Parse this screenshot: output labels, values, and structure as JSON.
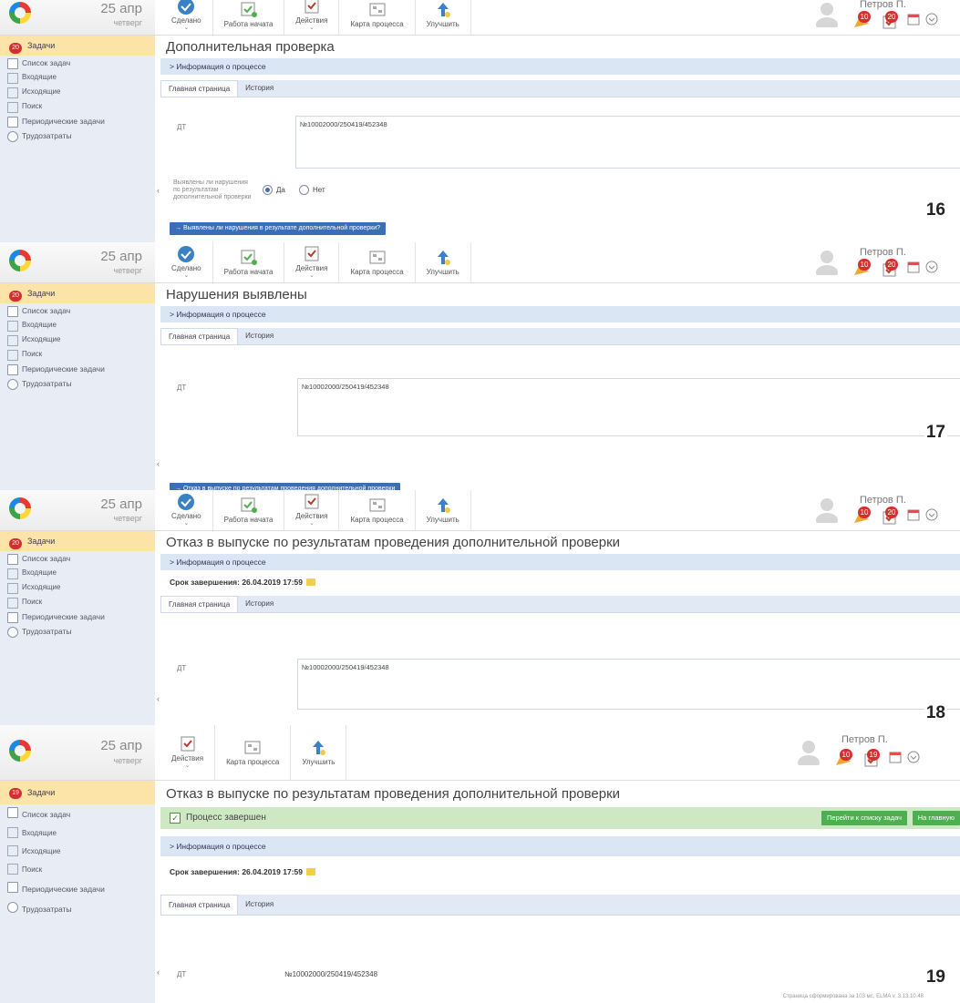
{
  "header": {
    "date_day": "25 апр",
    "weekday": "четверг",
    "user_name": "Петров П.",
    "user_name_partial": "Петров П."
  },
  "toolbar": {
    "done": "Сделано",
    "work_started": "Работа начата",
    "actions": "Действия",
    "process_map": "Карта процесса",
    "improve": "Улучшить"
  },
  "badges": {
    "notifications": "10",
    "tasks": "20",
    "tasks_last": "19"
  },
  "sidebar": {
    "tasks": "Задачи",
    "tasks_count": "20",
    "tasks_count_last": "19",
    "task_list": "Список задач",
    "incoming": "Входящие",
    "outgoing": "Исходящие",
    "search": "Поиск",
    "periodic": "Периодические задачи",
    "labor": "Трудозатраты"
  },
  "common": {
    "process_info": "> Информация о процессе",
    "tab_main": "Главная страница",
    "tab_history": "История",
    "field_dt": "ДТ",
    "dt_value": "№10002000/250419/452348",
    "deadline": "Срок завершения: 26.04.2019 17:59"
  },
  "panels": [
    {
      "number": "16",
      "title": "Дополнительная проверка",
      "question": "Выявлены ли нарушения по результатам дополнительной проверки",
      "radio_yes": "Да",
      "radio_no": "Нет",
      "action": "→ Выявлены ли нарушения в результате дополнительной проверки?"
    },
    {
      "number": "17",
      "title": "Нарушения выявлены",
      "action": "→ Отказ в выпуске по результатам проведения дополнительной проверки"
    },
    {
      "number": "18",
      "title": "Отказ в выпуске по результатам проведения дополнительной проверки"
    },
    {
      "number": "19",
      "title": "Отказ в выпуске по результатам проведения дополнительной проверки",
      "done": "Процесс завершен",
      "btn_go_list": "Перейти к списку задач",
      "btn_home": "На главную",
      "footer": "Страница сформирована за 103 мс. ELMA v. 3.13.10.48"
    }
  ]
}
